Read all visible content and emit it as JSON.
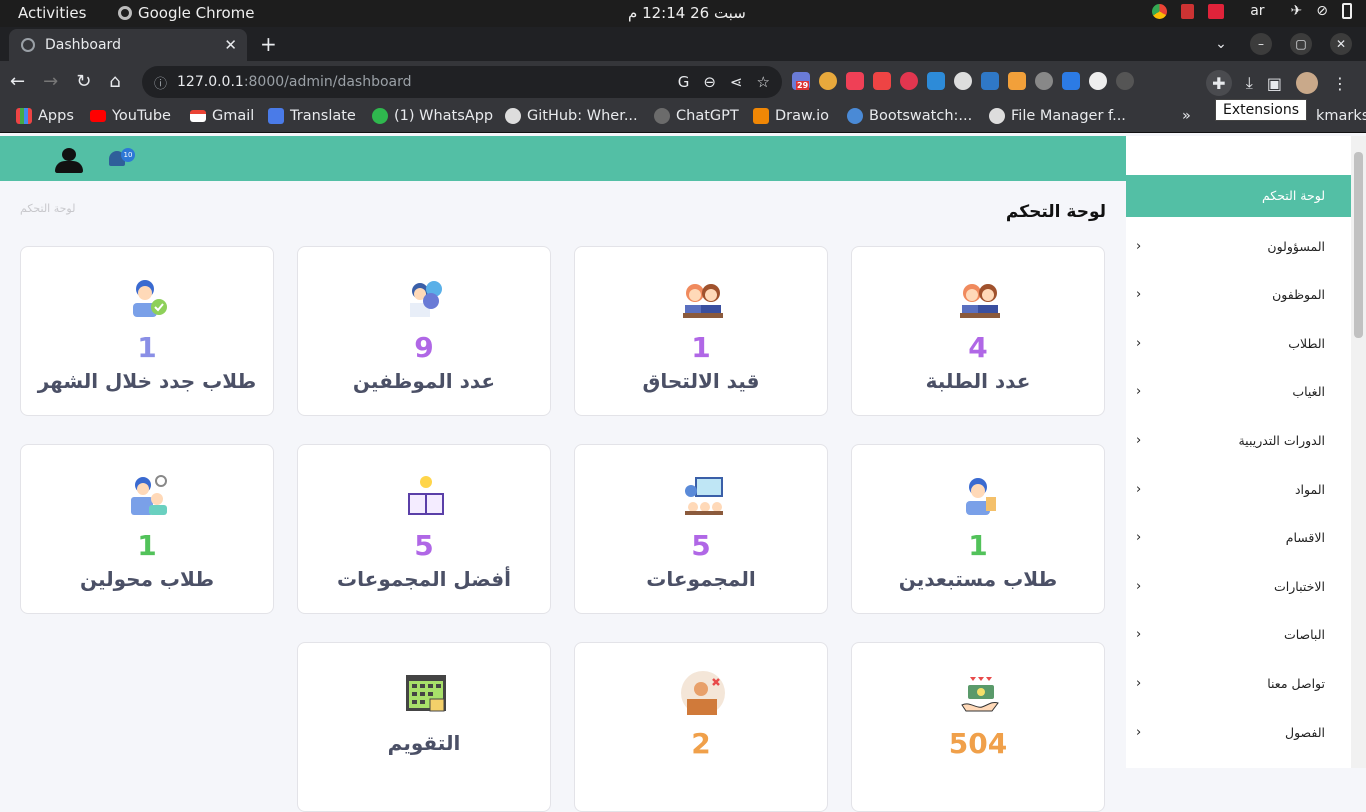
{
  "os": {
    "activities": "Activities",
    "app_name": "Google Chrome",
    "clock": "سبت 26  12:14 م",
    "lang": "ar"
  },
  "browser": {
    "tab_title": "Dashboard",
    "url_host": "127.0.0.1",
    "url_path": ":8000/admin/dashboard",
    "ext_badge": "29",
    "tooltip": "Extensions",
    "bookmarks": [
      "Apps",
      "YouTube",
      "Gmail",
      "Translate",
      "(1) WhatsApp",
      "GitHub: Wher...",
      "ChatGPT",
      "Draw.io",
      "Bootswatch:...",
      "File Manager f..."
    ],
    "bookmarks_overflow": "»",
    "bookmarks_folder_tail": "kmarks"
  },
  "header": {
    "notification_count": "10"
  },
  "breadcrumb": "لوحة التحكم",
  "page_title": "لوحة التحكم",
  "cards": [
    {
      "value": "4",
      "label": "عدد الطلبة",
      "color": "#b067e6",
      "icon": "students-icon"
    },
    {
      "value": "1",
      "label": "قيد الالتحاق",
      "color": "#b067e6",
      "icon": "enrolling-students-icon"
    },
    {
      "value": "9",
      "label": "عدد الموظفين",
      "color": "#b067e6",
      "icon": "employees-icon"
    },
    {
      "value": "1",
      "label": "طلاب جدد خلال الشهر",
      "color": "#8a8fe6",
      "icon": "new-student-icon"
    },
    {
      "value": "1",
      "label": "طلاب مستبعدين",
      "color": "#52c25a",
      "icon": "excluded-student-icon"
    },
    {
      "value": "5",
      "label": "المجموعات",
      "color": "#b067e6",
      "icon": "groups-icon"
    },
    {
      "value": "5",
      "label": "أفضل المجموعات",
      "color": "#b067e6",
      "icon": "best-groups-icon"
    },
    {
      "value": "1",
      "label": "طلاب محولين",
      "color": "#52c25a",
      "icon": "transferred-students-icon"
    },
    {
      "value": "504",
      "label": "",
      "color": "#f0a04a",
      "icon": "payments-icon"
    },
    {
      "value": "2",
      "label": "",
      "color": "#f0a04a",
      "icon": "absent-teacher-icon"
    },
    {
      "value": "",
      "label": "التقويم",
      "color": "#4b5066",
      "icon": "calendar-icon"
    }
  ],
  "sidebar": {
    "active": "لوحة التحكم",
    "items": [
      "المسؤولون",
      "الموظفون",
      "الطلاب",
      "الغياب",
      "الدورات التدريبية",
      "المواد",
      "الاقسام",
      "الاختبارات",
      "الباصات",
      "تواصل معنا",
      "الفصول"
    ]
  },
  "colors": {
    "accent": "#53bfa5"
  }
}
